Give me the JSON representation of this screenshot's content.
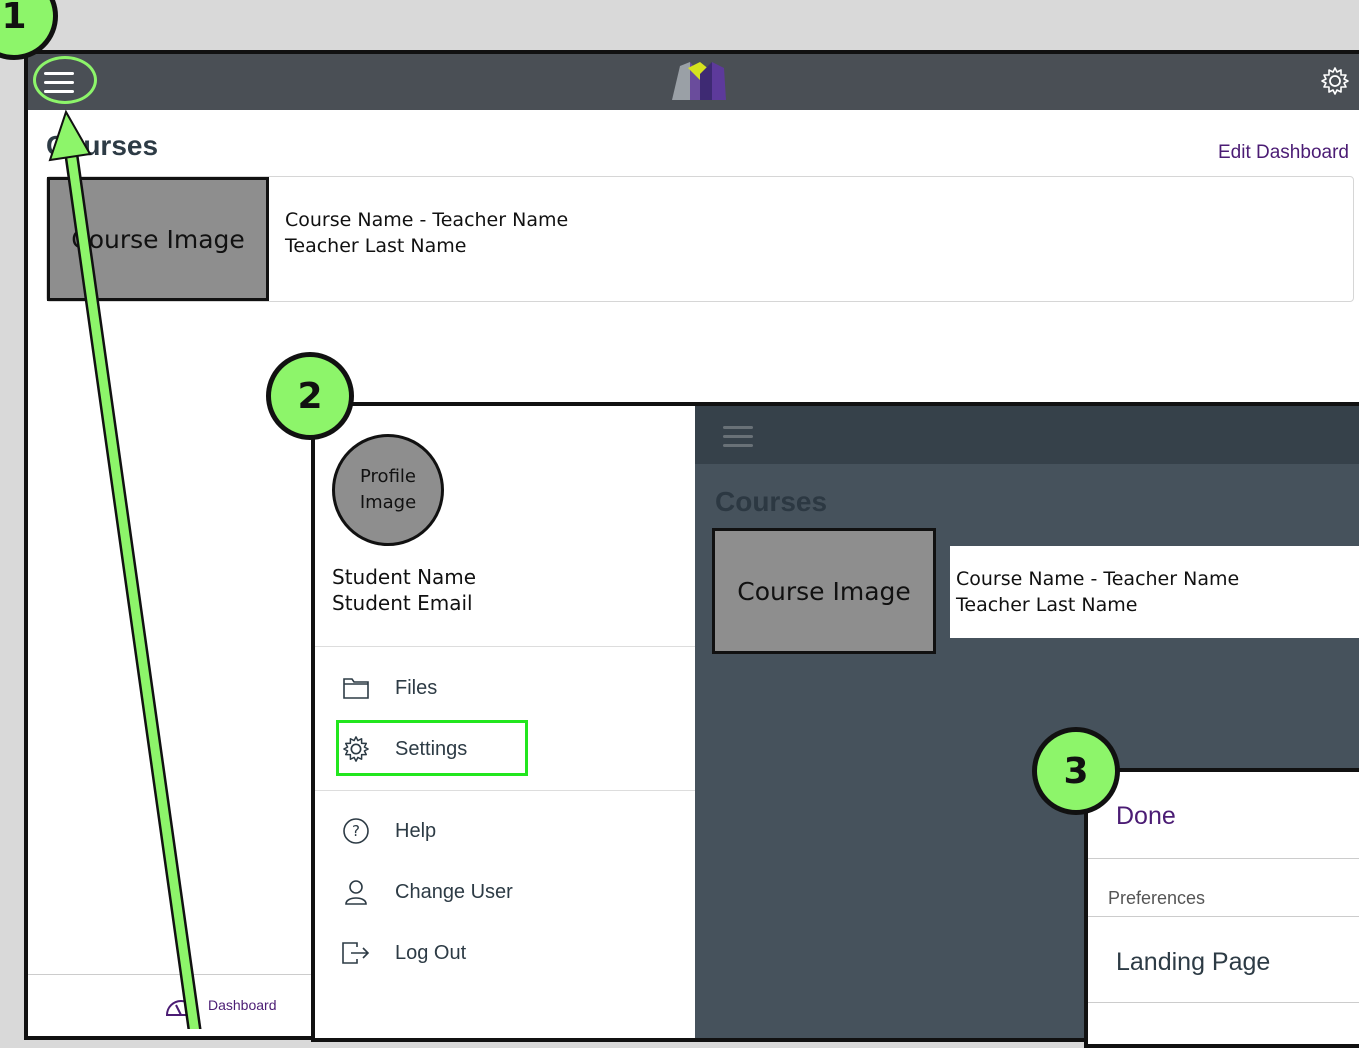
{
  "steps": [
    "1",
    "2",
    "3"
  ],
  "screen1": {
    "page_title": "Courses",
    "edit_dashboard": "Edit Dashboard",
    "course_image": "Course Image",
    "course_name": "Course Name - Teacher Name",
    "teacher_last": "Teacher Last Name",
    "bottom_nav_label": "Dashboard"
  },
  "drawer": {
    "profile_line1": "Profile",
    "profile_line2": "Image",
    "student_name": "Student Name",
    "student_email": "Student Email",
    "items": [
      {
        "label": "Files",
        "icon": "folder-icon"
      },
      {
        "label": "Settings",
        "icon": "gear-icon"
      },
      {
        "label": "Help",
        "icon": "help-icon"
      },
      {
        "label": "Change User",
        "icon": "user-icon"
      },
      {
        "label": "Log Out",
        "icon": "logout-icon"
      }
    ]
  },
  "screen2": {
    "page_title": "Courses",
    "course_image": "Course Image",
    "course_name": "Course Name - Teacher Name",
    "teacher_last": "Teacher Last Name"
  },
  "settings_panel": {
    "done": "Done",
    "section": "Preferences",
    "landing_page": "Landing Page"
  },
  "colors": {
    "highlight": "#8df56a",
    "accent_purple": "#4b1c74",
    "topbar": "#4a4f55"
  }
}
